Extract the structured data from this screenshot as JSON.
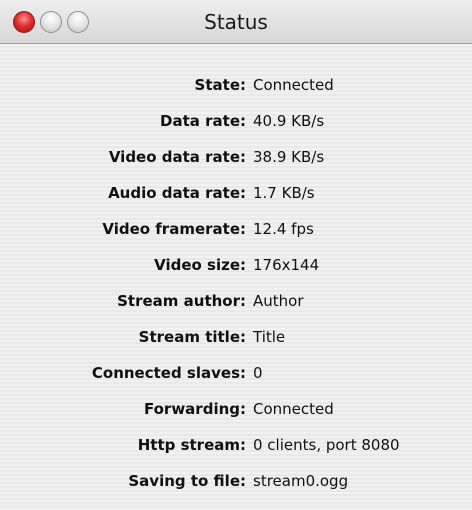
{
  "window": {
    "title": "Status"
  },
  "colors": {
    "close_button": "#e0302e",
    "inactive_button": "#dcdcdc",
    "background": "#ececec"
  },
  "status": {
    "rows": [
      {
        "label": "State:",
        "value": "Connected"
      },
      {
        "label": "Data rate:",
        "value": "40.9 KB/s"
      },
      {
        "label": "Video data rate:",
        "value": "38.9 KB/s"
      },
      {
        "label": "Audio data rate:",
        "value": "1.7 KB/s"
      },
      {
        "label": "Video framerate:",
        "value": "12.4 fps"
      },
      {
        "label": "Video size:",
        "value": "176x144"
      },
      {
        "label": "Stream author:",
        "value": "Author"
      },
      {
        "label": "Stream title:",
        "value": "Title"
      },
      {
        "label": "Connected slaves:",
        "value": "0"
      },
      {
        "label": "Forwarding:",
        "value": "Connected"
      },
      {
        "label": "Http stream:",
        "value": "0 clients, port 8080"
      },
      {
        "label": "Saving to file:",
        "value": "stream0.ogg"
      }
    ]
  }
}
